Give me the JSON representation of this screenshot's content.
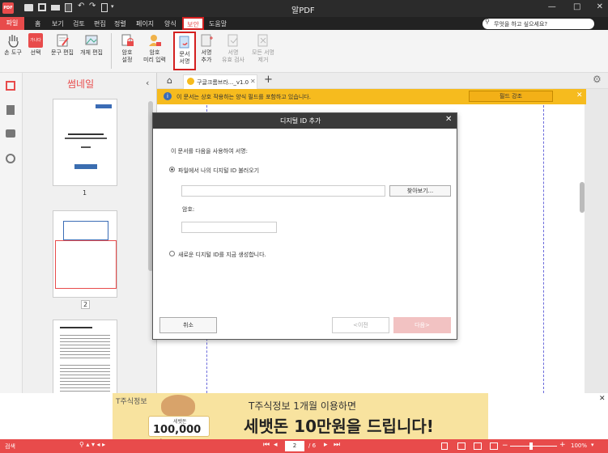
{
  "app": {
    "title": "알PDF",
    "logo": "PDF"
  },
  "menu": [
    "파일",
    "홈",
    "보기",
    "검토",
    "편집",
    "정렬",
    "페이지",
    "양식",
    "보안",
    "도움말"
  ],
  "search": {
    "placeholder": "무엇을 하고 싶으세요?"
  },
  "ribbon": {
    "hand": "손 도구",
    "select": "선택",
    "select_badge": "가나다",
    "text_edit": "문구 편집",
    "object_edit": "개체 편집",
    "pw_set": [
      "암호",
      "설정"
    ],
    "pw_preview": [
      "암호",
      "미리 입력"
    ],
    "doc_sign": [
      "문서",
      "서명"
    ],
    "sign_add": [
      "서명",
      "추가"
    ],
    "sign_check": [
      "서명",
      "유효 검사"
    ],
    "sign_remove_all": [
      "모든 서명",
      "제거"
    ]
  },
  "thumbs": {
    "title": "썸네일",
    "pages": [
      "1",
      "2"
    ]
  },
  "tab": {
    "name": "구글크롬브라..._v1.0"
  },
  "notice": {
    "text": "이 문서는 상호 작용하는 양식 필드를 포함하고 있습니다.",
    "button": "필드 강조"
  },
  "dialog": {
    "title": "디지털 ID 추가",
    "intro": "이 문서를 다음을 사용하여 서명:",
    "opt1": "파일에서 나의 디지털 ID 불러오기",
    "browse": "찾아보기...",
    "pw_label": "암호:",
    "opt2": "새로운 디지털 ID를 지금 생성합니다.",
    "cancel": "취소",
    "prev": "<이전",
    "next": "다음>"
  },
  "ad": {
    "brand": "T주식정보",
    "headline": "T주식정보 1개월 이용하면",
    "big": "세뱃돈 10만원을 드립니다!",
    "coupon_small": "세뱃돈",
    "coupon_amount": "100,000원"
  },
  "status": {
    "search": "검색",
    "page_current": "2",
    "page_total": "/ 6",
    "zoom": "100%"
  },
  "colors": {
    "accent": "#e84b4b",
    "notice": "#f6bb1e",
    "dialog_header": "#3a3a3a"
  }
}
